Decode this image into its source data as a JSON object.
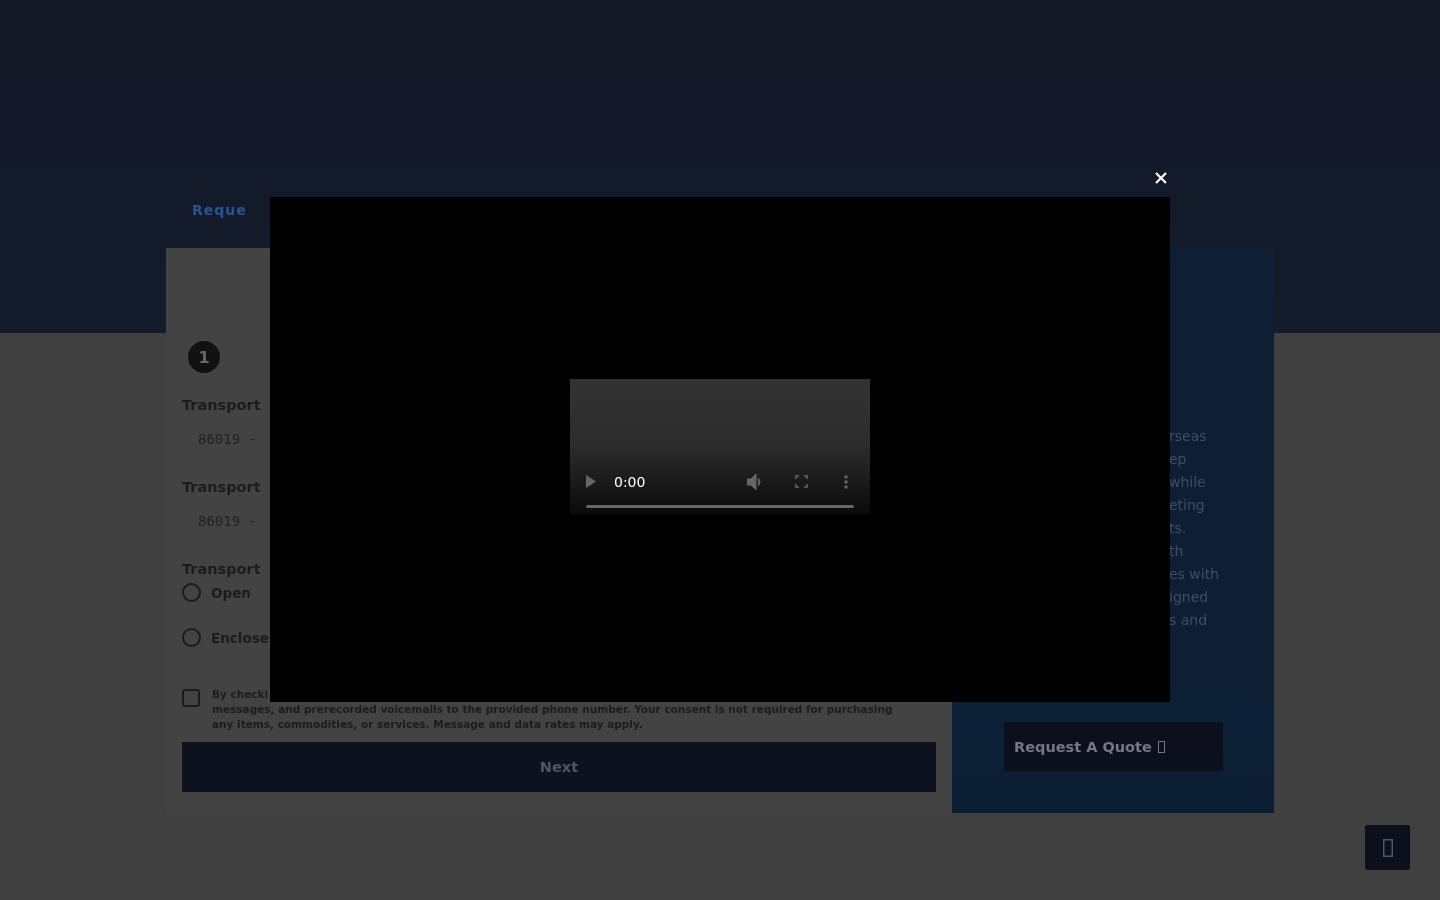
{
  "header": {
    "breadcrumb": "Reque"
  },
  "form": {
    "step": "1",
    "fields": [
      {
        "label": "Transport",
        "placeholder": "86019 -"
      },
      {
        "label": "Transport",
        "placeholder": "86019 -"
      }
    ],
    "transport_type": {
      "label": "Transport",
      "options": [
        {
          "label": "Open",
          "selected": false
        },
        {
          "label": "Enclose",
          "selected": false
        }
      ]
    },
    "consent": {
      "checked": false,
      "lead": "By checki",
      "text": "messages, and prerecorded voicemails to the provided phone number. Your consent is not required for purchasing\nany items, commodities, or services. Message and data rates may apply."
    },
    "next_button": "Next"
  },
  "info_panel": {
    "text": "rseas\nep\nwhile\neting\nts.\nth\nes with\nigned\ns and",
    "button": "Request A Quote"
  },
  "video_modal": {
    "time": "0:00",
    "progress": {
      "level": 0
    }
  }
}
